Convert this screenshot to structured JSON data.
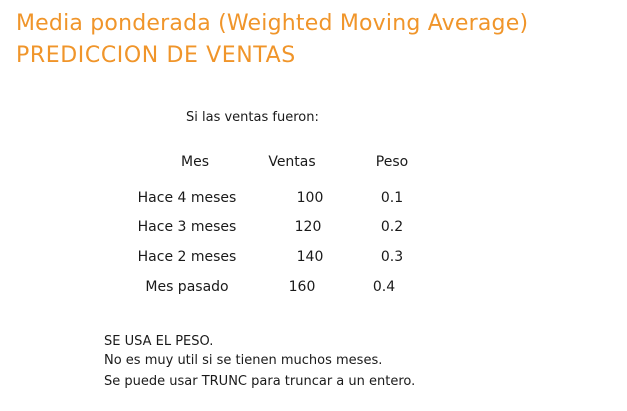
{
  "colors": {
    "title": "#f0952a",
    "text": "#1a1a1a",
    "background": "#ffffff"
  },
  "title": {
    "line1": "Media ponderada (Weighted Moving Average)",
    "line2": "PREDICCION DE VENTAS"
  },
  "intro": "Si las ventas fueron:",
  "table": {
    "headers": {
      "mes": "Mes",
      "ventas": "Ventas",
      "peso": "Peso"
    },
    "rows": [
      {
        "mes": "Hace 4 meses",
        "ventas": "100",
        "peso": "0.1"
      },
      {
        "mes": "Hace 3 meses",
        "ventas": "120",
        "peso": "0.2"
      },
      {
        "mes": "Hace 2 meses",
        "ventas": "140",
        "peso": "0.3"
      },
      {
        "mes": "Mes pasado",
        "ventas": "160",
        "peso": "0.4"
      }
    ]
  },
  "notes": [
    "SE USA EL PESO.",
    "No es muy util si se tienen muchos meses.",
    "Se puede usar TRUNC para truncar a un entero."
  ]
}
